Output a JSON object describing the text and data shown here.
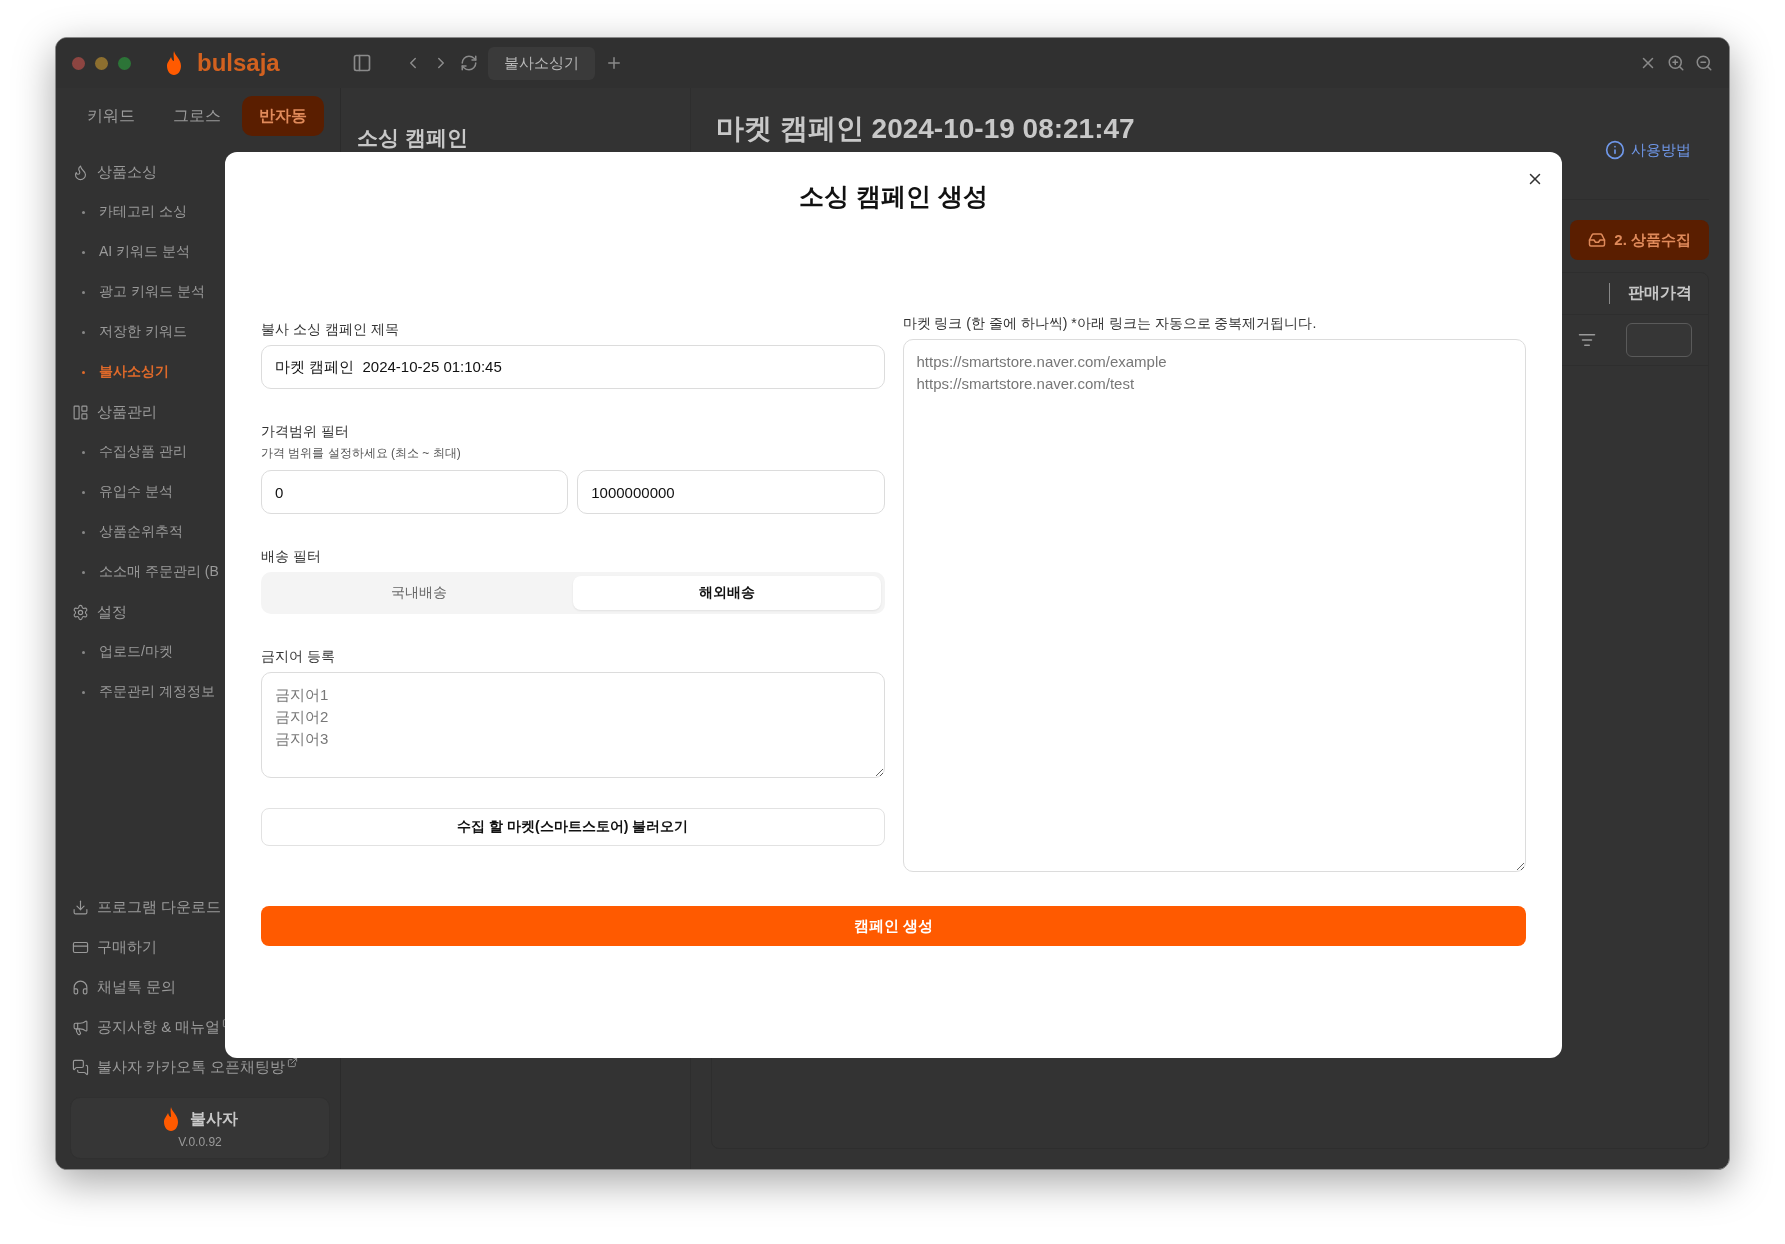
{
  "window": {
    "logo": "bulsaja",
    "tab": "불사소싱기"
  },
  "sidebar": {
    "modes": [
      {
        "label": "키워드",
        "selected": false
      },
      {
        "label": "그로스",
        "selected": false
      },
      {
        "label": "반자동",
        "selected": true
      }
    ],
    "menu": [
      {
        "label": "상품소싱",
        "selected": false,
        "children": [
          {
            "label": "카테고리 소싱",
            "selected": false
          },
          {
            "label": "AI 키워드 분석",
            "selected": false
          },
          {
            "label": "광고 키워드 분석",
            "selected": false
          },
          {
            "label": "저장한 키워드",
            "selected": false
          },
          {
            "label": "불사소싱기",
            "selected": true
          }
        ]
      },
      {
        "label": "상품관리",
        "selected": false,
        "children": [
          {
            "label": "수집상품 관리",
            "selected": false
          },
          {
            "label": "유입수 분석",
            "selected": false
          },
          {
            "label": "상품순위추적",
            "selected": false
          },
          {
            "label": "소소매 주문관리 (B",
            "selected": false
          }
        ]
      },
      {
        "label": "설정",
        "selected": false,
        "children": [
          {
            "label": "업로드/마켓",
            "selected": false
          },
          {
            "label": "주문관리 계정정보",
            "selected": false
          }
        ]
      }
    ],
    "links": [
      {
        "label": "프로그램 다운로드",
        "external": false
      },
      {
        "label": "구매하기",
        "external": false
      },
      {
        "label": "채널톡 문의",
        "external": false
      },
      {
        "label": "공지사항 & 매뉴얼",
        "external": true
      },
      {
        "label": "불사자 카카오톡 오픈채팅방",
        "external": true
      }
    ],
    "footer": {
      "name": "불사자",
      "version": "V.0.0.92"
    }
  },
  "middle": {
    "title": "소싱 캠페인"
  },
  "main": {
    "title": "마켓 캠페인 2024-10-19 08:21:47",
    "help": "사용방법",
    "collect_button": "2. 상품수집",
    "column": "판매가격"
  },
  "modal": {
    "title": "소싱 캠페인 생성",
    "name_field": {
      "label": "불사 소싱 캠페인 제목",
      "value": "마켓 캠페인  2024-10-25 01:10:45"
    },
    "price_filter": {
      "label": "가격범위 필터",
      "hint": "가격 범위를 설정하세요 (최소 ~ 최대)",
      "min": "0",
      "max": "1000000000"
    },
    "shipping_filter": {
      "label": "배송 필터",
      "options": [
        {
          "label": "국내배송",
          "selected": false
        },
        {
          "label": "해외배송",
          "selected": true
        }
      ]
    },
    "banned_words": {
      "label": "금지어 등록",
      "placeholder": "금지어1\n금지어2\n금지어3"
    },
    "load_button": "수집 할 마켓(스마트스토어) 불러오기",
    "links_field": {
      "label": "마켓 링크 (한 줄에 하나씩) *아래 링크는 자동으로 중복제거됩니다.",
      "placeholder": "https://smartstore.naver.com/example\nhttps://smartstore.naver.com/test"
    },
    "submit_button": "캠페인 생성"
  }
}
